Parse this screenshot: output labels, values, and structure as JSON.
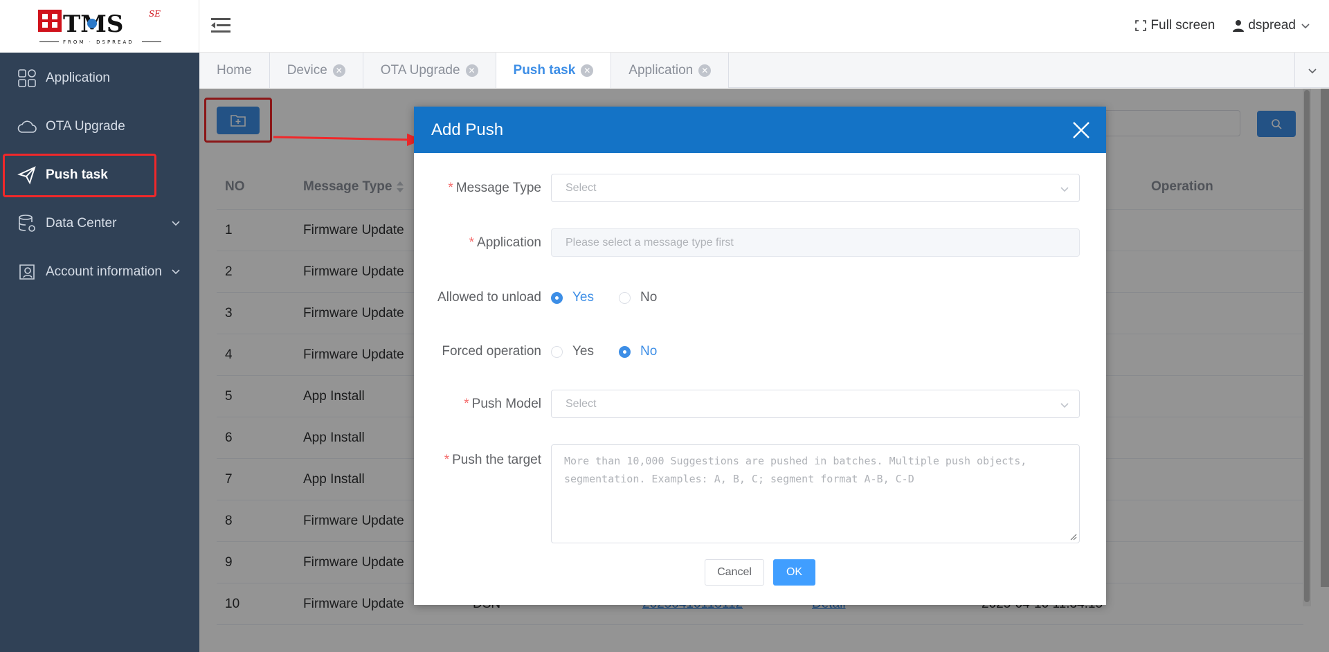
{
  "logo": {
    "text": "TMS",
    "sup": "SE",
    "tagline": "FROM·DSPREAD"
  },
  "sidebar": {
    "items": [
      {
        "label": "Application",
        "icon": "grid-icon"
      },
      {
        "label": "OTA Upgrade",
        "icon": "cloud-icon"
      },
      {
        "label": "Push task",
        "icon": "paper-plane-icon",
        "active": true
      },
      {
        "label": "Data Center",
        "icon": "database-icon",
        "expandable": true
      },
      {
        "label": "Account information",
        "icon": "user-card-icon",
        "expandable": true
      }
    ]
  },
  "header": {
    "fullscreen_label": "Full screen",
    "user_label": "dspread"
  },
  "tabs": [
    {
      "label": "Home",
      "closable": false
    },
    {
      "label": "Device",
      "closable": true
    },
    {
      "label": "OTA Upgrade",
      "closable": true
    },
    {
      "label": "Push task",
      "closable": true,
      "active": true
    },
    {
      "label": "Application",
      "closable": true
    }
  ],
  "table": {
    "headers": {
      "no": "NO",
      "type": "Message Type",
      "op": "Operation"
    },
    "rows": [
      {
        "no": "1",
        "type": "Firmware Update"
      },
      {
        "no": "2",
        "type": "Firmware Update"
      },
      {
        "no": "3",
        "type": "Firmware Update"
      },
      {
        "no": "4",
        "type": "Firmware Update"
      },
      {
        "no": "5",
        "type": "App Install"
      },
      {
        "no": "6",
        "type": "App Install"
      },
      {
        "no": "7",
        "type": "App Install"
      },
      {
        "no": "8",
        "type": "Firmware Update"
      },
      {
        "no": "9",
        "type": "Firmware Update"
      },
      {
        "no": "10",
        "type": "Firmware Update"
      }
    ],
    "partial_last_row": {
      "sn": "DSN",
      "id": "20250410113112",
      "detail": "Detail",
      "time": "2025-04-10 11:34:15"
    }
  },
  "dialog": {
    "title": "Add Push",
    "message_type": {
      "label": "Message Type",
      "placeholder": "Select"
    },
    "application": {
      "label": "Application",
      "placeholder": "Please select a message type first"
    },
    "allowed_unload": {
      "label": "Allowed to unload",
      "yes": "Yes",
      "no": "No",
      "selected": "Yes"
    },
    "forced_operation": {
      "label": "Forced operation",
      "yes": "Yes",
      "no": "No",
      "selected": "No"
    },
    "push_model": {
      "label": "Push Model",
      "placeholder": "Select"
    },
    "push_target": {
      "label": "Push the target",
      "placeholder": "More than 10,000 Suggestions are pushed in batches. Multiple push objects, segmentation. Examples: A, B, C; segment format A-B, C-D"
    },
    "cancel_label": "Cancel",
    "ok_label": "OK"
  },
  "colors": {
    "sidebar_bg": "#304156",
    "primary": "#3d8ee6",
    "dialog_header": "#1473c6",
    "highlight": "#f0282a",
    "required": "#f56c6c"
  }
}
